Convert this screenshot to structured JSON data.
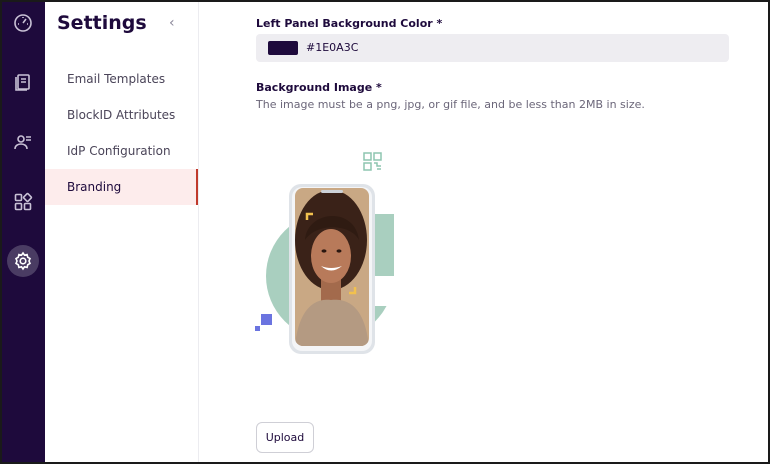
{
  "rail": {
    "background": "#1E0A3C",
    "items": [
      {
        "icon": "dashboard-icon"
      },
      {
        "icon": "book-icon"
      },
      {
        "icon": "users-icon"
      },
      {
        "icon": "apps-grid-icon"
      },
      {
        "icon": "gear-icon",
        "active": true
      }
    ]
  },
  "settings": {
    "title": "Settings",
    "collapse_icon": "chevron-left-icon",
    "nav": [
      {
        "label": "Email Templates"
      },
      {
        "label": "BlockID Attributes"
      },
      {
        "label": "IdP Configuration"
      },
      {
        "label": "Branding",
        "active": true
      }
    ]
  },
  "branding": {
    "left_panel_color_label": "Left Panel Background Color *",
    "left_panel_color_value": "#1E0A3C",
    "left_panel_color_text": "#1E0A3C",
    "background_image_label": "Background Image *",
    "background_image_help": "The image must be a png, jpg, or gif file, and be less than 2MB in size.",
    "upload_label": "Upload"
  },
  "colors": {
    "accent": "#1E0A3C",
    "active_nav_bg": "#fdecec",
    "active_nav_border": "#c0392b",
    "illustration_green": "#a9cfbf",
    "illustration_blue": "#6b74e0",
    "illustration_corner": "#f2c14e"
  }
}
